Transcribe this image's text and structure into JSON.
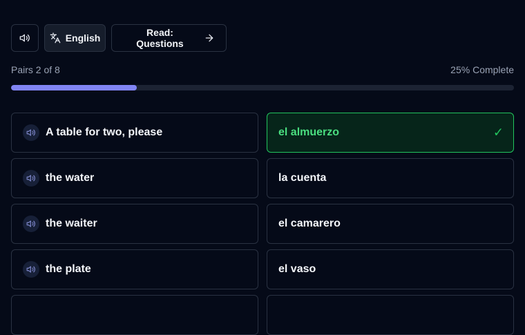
{
  "toolbar": {
    "audio_icon": "speaker-icon",
    "language_label": "English",
    "language_icon": "translate-icon",
    "read_label": "Read: Questions",
    "read_icon": "arrow-right-icon"
  },
  "progress": {
    "pairs_label": "Pairs 2 of 8",
    "complete_label": "25% Complete",
    "fraction": 0.25,
    "fill_color": "#8185f4"
  },
  "left_items": [
    {
      "label": "A table for two, please",
      "icon": "speaker-icon"
    },
    {
      "label": "the water",
      "icon": "speaker-icon"
    },
    {
      "label": "the waiter",
      "icon": "speaker-icon"
    },
    {
      "label": "the plate",
      "icon": "speaker-icon"
    }
  ],
  "right_items": [
    {
      "label": "el almuerzo",
      "state": "matched",
      "icon": "check-icon"
    },
    {
      "label": "la cuenta",
      "state": "default"
    },
    {
      "label": "el camarero",
      "state": "default"
    },
    {
      "label": "el vaso",
      "state": "default"
    }
  ],
  "colors": {
    "background": "#050a18",
    "accent": "#8185f4",
    "success": "#22c55e"
  }
}
